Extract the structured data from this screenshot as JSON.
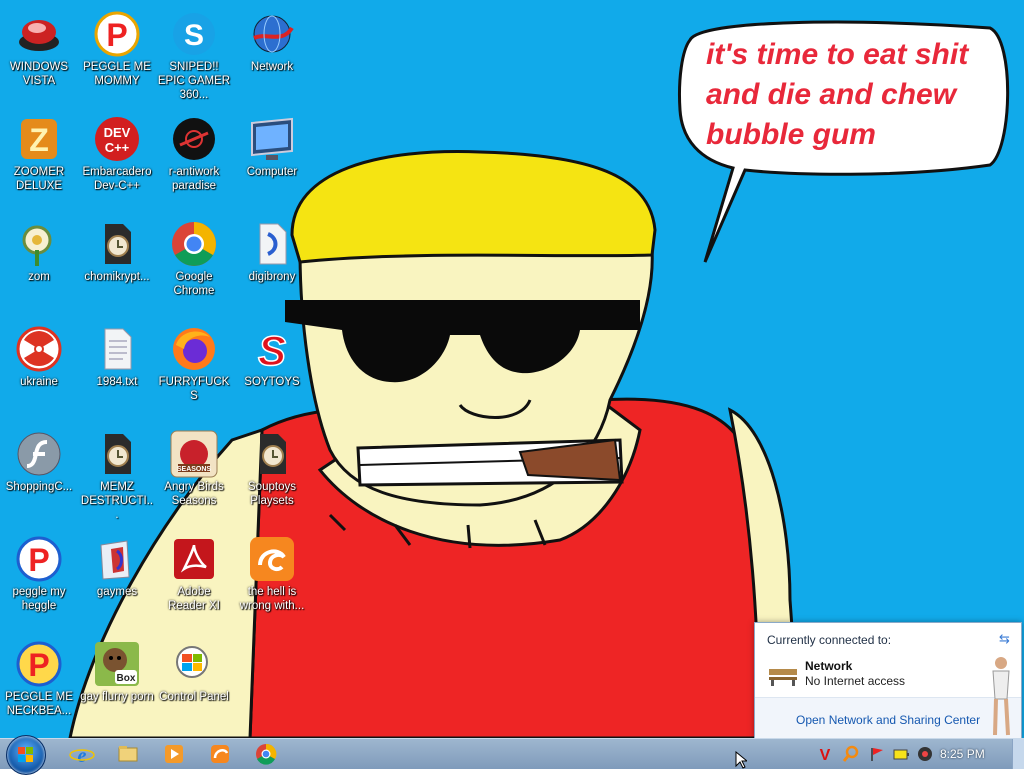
{
  "wallpaper": {
    "speech_lines": [
      "it's time to eat shit",
      "and die and chew",
      "bubble gum"
    ],
    "background_color": "#11aaea"
  },
  "desktop_icons": [
    {
      "label": "WINDOWS VISTA",
      "icon": "vista-car-icon"
    },
    {
      "label": "PEGGLE ME MOMMY",
      "icon": "peggle-icon"
    },
    {
      "label": "SNIPED!! EPIC GAMER 360...",
      "icon": "skype-icon"
    },
    {
      "label": "Network",
      "icon": "network-globe-icon"
    },
    {
      "label": "ZOOMER DELUXE",
      "icon": "zoomer-deluxe-icon"
    },
    {
      "label": "Embarcadero Dev-C++",
      "icon": "devcpp-icon"
    },
    {
      "label": "r-antiwork paradise",
      "icon": "antiwork-icon"
    },
    {
      "label": "Computer",
      "icon": "computer-icon"
    },
    {
      "label": "zom",
      "icon": "plants-vs-zombies-icon"
    },
    {
      "label": "chomikrypt...",
      "icon": "shortcut-file-icon"
    },
    {
      "label": "Google Chrome",
      "icon": "chrome-icon"
    },
    {
      "label": "digibrony",
      "icon": "digibrony-icon"
    },
    {
      "label": "ukraine",
      "icon": "radiation-icon"
    },
    {
      "label": "1984.txt",
      "icon": "text-file-icon"
    },
    {
      "label": "FURRYFUCKS",
      "icon": "firefox-icon"
    },
    {
      "label": "SOYTOYS",
      "icon": "soytoys-icon"
    },
    {
      "label": "ShoppingC...",
      "icon": "flash-icon"
    },
    {
      "label": "MEMZ DESTRUCTI...",
      "icon": "shortcut-file-icon"
    },
    {
      "label": "Angry Birds Seasons",
      "icon": "angry-birds-icon"
    },
    {
      "label": "Souptoys Playsets",
      "icon": "shortcut-file-icon"
    },
    {
      "label": "peggle my heggle",
      "icon": "peggle-icon"
    },
    {
      "label": "gaymes",
      "icon": "folder-icon"
    },
    {
      "label": "Adobe Reader XI",
      "icon": "adobe-reader-icon"
    },
    {
      "label": "the hell is wrong with...",
      "icon": "uc-browser-icon"
    },
    {
      "label": "PEGGLE ME NECKBEA...",
      "icon": "peggle-icon"
    },
    {
      "label": "gay flurry porn",
      "icon": "box-beaver-icon"
    },
    {
      "label": "Control Panel",
      "icon": "control-panel-icon"
    }
  ],
  "taskbar": {
    "pinned": [
      "internet-explorer-icon",
      "explorer-folder-icon",
      "media-player-icon",
      "uc-browser-icon",
      "chrome-icon"
    ],
    "tray": [
      "vivaldi-icon",
      "search-icon",
      "flag-icon",
      "battery-icon",
      "volume-icon"
    ],
    "clock": "8:25 PM"
  },
  "network_popup": {
    "header": "Currently connected to:",
    "network_name": "Network",
    "status": "No Internet access",
    "link": "Open Network and Sharing Center"
  }
}
